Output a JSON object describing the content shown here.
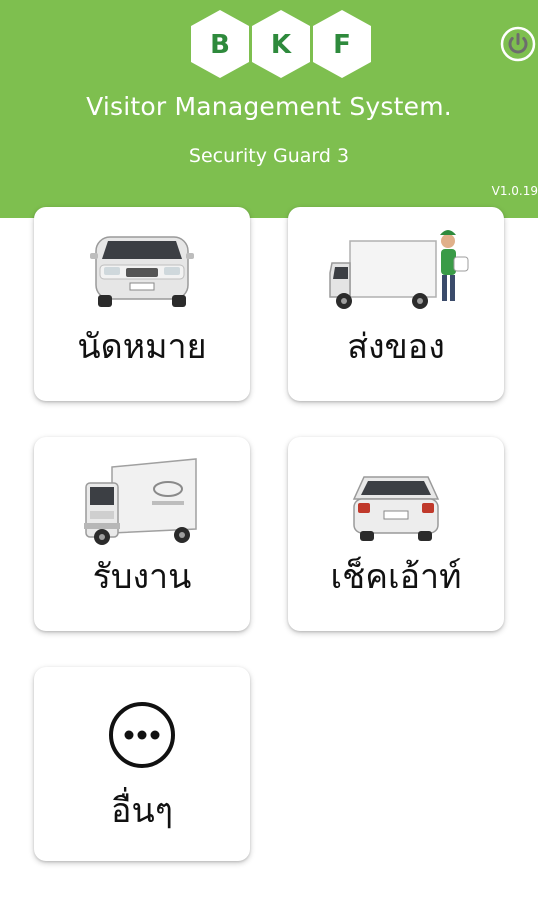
{
  "header": {
    "logo_letters": [
      "B",
      "K",
      "F"
    ],
    "title": "Visitor Management System.",
    "subtitle": "Security Guard 3",
    "version": "V1.0.19",
    "background_color": "#7ebf4f",
    "brand_color": "#2e8a3c",
    "power_icon": "power-icon"
  },
  "menu": {
    "items": [
      {
        "label": "นัดหมาย",
        "icon": "car-front-icon"
      },
      {
        "label": "ส่งของ",
        "icon": "delivery-truck-icon"
      },
      {
        "label": "รับงาน",
        "icon": "box-truck-icon"
      },
      {
        "label": "เช็คเอ้าท์",
        "icon": "car-rear-icon"
      },
      {
        "label": "อื่นๆ",
        "icon": "more-icon"
      }
    ]
  }
}
